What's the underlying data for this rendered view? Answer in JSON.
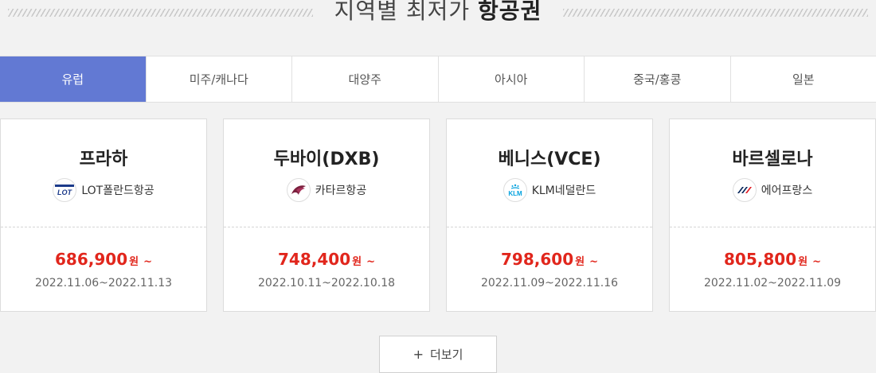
{
  "section": {
    "title_light": "지역별 최저가",
    "title_bold": "항공권"
  },
  "tabs": [
    {
      "label": "유럽",
      "active": true
    },
    {
      "label": "미주/캐나다",
      "active": false
    },
    {
      "label": "대양주",
      "active": false
    },
    {
      "label": "아시아",
      "active": false
    },
    {
      "label": "중국/홍콩",
      "active": false
    },
    {
      "label": "일본",
      "active": false
    }
  ],
  "cards": [
    {
      "city": "프라하",
      "airline": "LOT폴란드항공",
      "logo_icon": "lot-polish-airlines-logo",
      "price": "686,900",
      "currency": "원",
      "suffix": "~",
      "dates": "2022.11.06~2022.11.13"
    },
    {
      "city": "두바이(DXB)",
      "airline": "카타르항공",
      "logo_icon": "qatar-airways-logo",
      "price": "748,400",
      "currency": "원",
      "suffix": "~",
      "dates": "2022.10.11~2022.10.18"
    },
    {
      "city": "베니스(VCE)",
      "airline": "KLM네덜란드",
      "logo_icon": "klm-logo",
      "price": "798,600",
      "currency": "원",
      "suffix": "~",
      "dates": "2022.11.09~2022.11.16"
    },
    {
      "city": "바르셀로나",
      "airline": "에어프랑스",
      "logo_icon": "air-france-logo",
      "price": "805,800",
      "currency": "원",
      "suffix": "~",
      "dates": "2022.11.02~2022.11.09"
    }
  ],
  "more_button": {
    "label": "더보기",
    "icon": "plus-icon"
  },
  "colors": {
    "accent": "#6279d3",
    "price": "#e1261c"
  }
}
